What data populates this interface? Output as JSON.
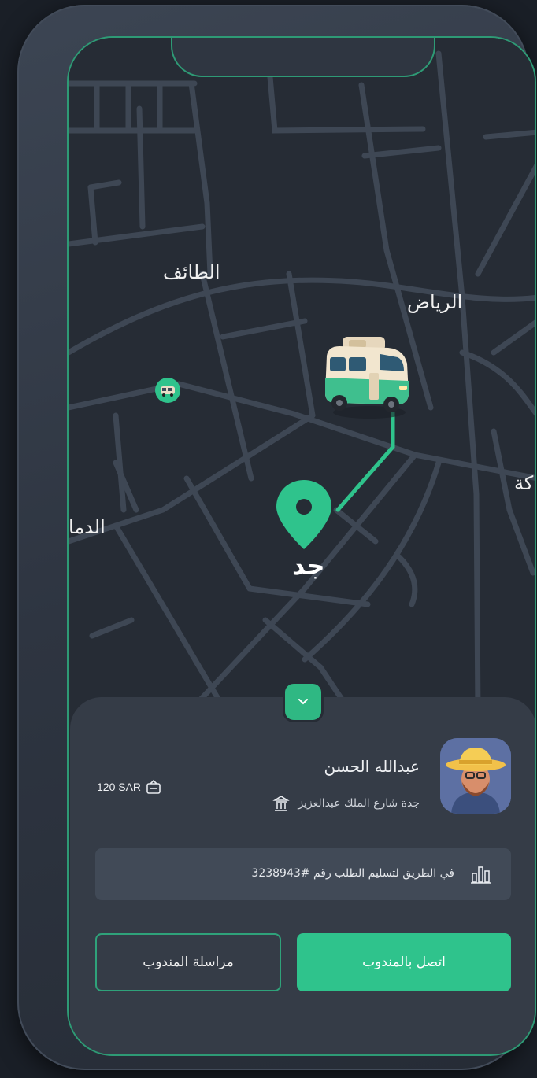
{
  "map": {
    "cities": [
      {
        "name": "الطائف"
      },
      {
        "name": "الرياض"
      },
      {
        "name": "كة"
      },
      {
        "name": "الدما"
      },
      {
        "name": "جد"
      }
    ]
  },
  "driver": {
    "name": "عبدالله الحسن",
    "address": "جدة شارع الملك عبدالعزيز",
    "price": "120 SAR"
  },
  "status": {
    "text": "في الطريق لتسليم الطلب رقم #3238943"
  },
  "actions": {
    "call_label": "اتصل بالمندوب",
    "message_label": "مراسلة المندوب"
  },
  "colors": {
    "accent": "#2fc38c",
    "background": "#262c35",
    "sheet": "#353c47"
  },
  "icons": [
    "chevron-down-icon",
    "wallet-icon",
    "building-icon",
    "chart-icon",
    "delivery-van-icon",
    "location-pin-icon"
  ]
}
